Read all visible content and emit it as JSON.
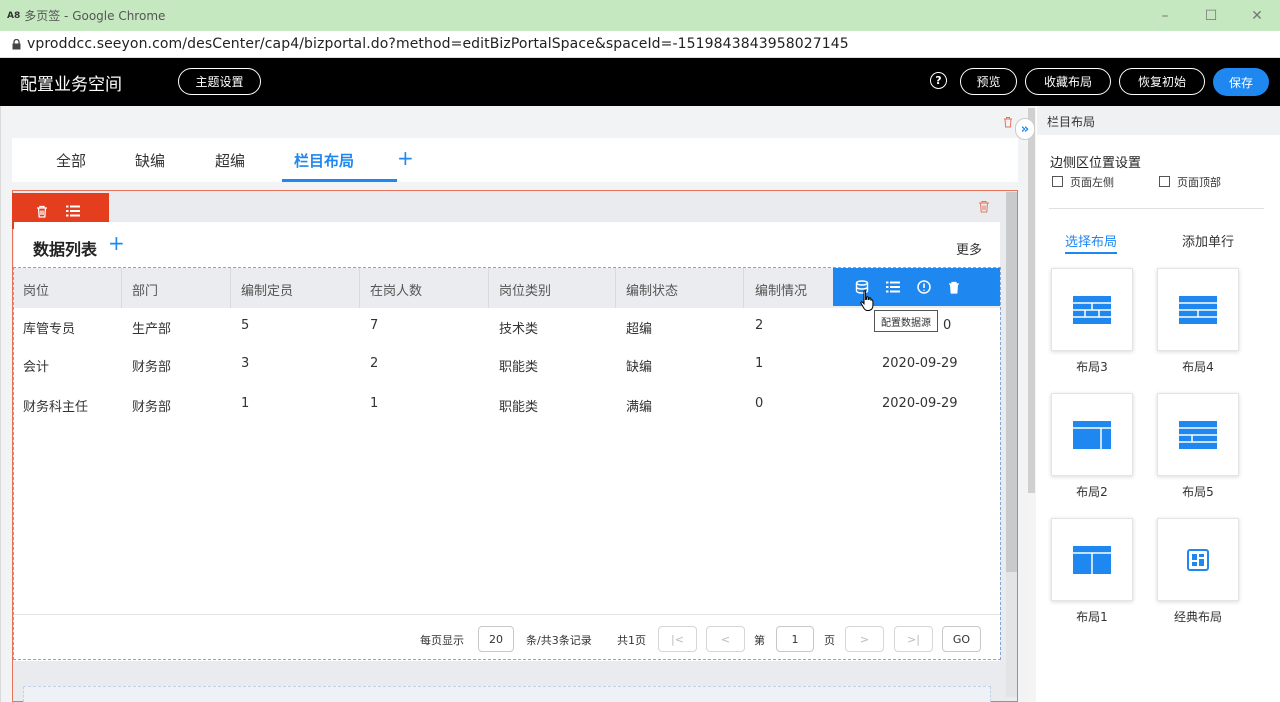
{
  "browser": {
    "app_icon": "A8",
    "window_title": "多页签 - Google Chrome",
    "url": "vproddcc.seeyon.com/desCenter/cap4/bizportal.do?method=editBizPortalSpace&spaceId=-1519843843958027145",
    "minimize": "–",
    "maximize": "☐",
    "close": "✕"
  },
  "header": {
    "title": "配置业务空间",
    "theme_button": "主题设置",
    "help": "?",
    "preview_button": "预览",
    "collect_button": "收藏布局",
    "restore_button": "恢复初始",
    "save_button": "保存"
  },
  "tabs": {
    "items": [
      "全部",
      "缺编",
      "超编",
      "栏目布局"
    ],
    "active_index": 3,
    "add": "+"
  },
  "panel": {
    "title": "数据列表",
    "add": "+",
    "more": "更多"
  },
  "table": {
    "columns": [
      "岗位",
      "部门",
      "编制定员",
      "在岗人数",
      "岗位类别",
      "编制状态",
      "编制情况"
    ],
    "rows": [
      [
        "库管专员",
        "生产部",
        "5",
        "7",
        "技术类",
        "超编",
        "2",
        "0"
      ],
      [
        "会计",
        "财务部",
        "3",
        "2",
        "职能类",
        "缺编",
        "1",
        "2020-09-29"
      ],
      [
        "财务科主任",
        "财务部",
        "1",
        "1",
        "职能类",
        "满编",
        "0",
        "2020-09-29"
      ]
    ]
  },
  "hover_toolbar": {
    "tooltip": "配置数据源",
    "icons": [
      "database-icon",
      "list-icon",
      "info-icon",
      "trash-icon"
    ]
  },
  "pager": {
    "per_page_label": "每页显示",
    "per_page_value": "20",
    "summary": "条/共3条记录",
    "total_pages": "共1页",
    "first": "|<",
    "prev": "<",
    "page_label": "第",
    "page_value": "1",
    "page_suffix": "页",
    "next": ">",
    "last": ">|",
    "go": "GO"
  },
  "right_panel": {
    "header": "栏目布局",
    "section_title": "边侧区位置设置",
    "checkbox_left": "页面左侧",
    "checkbox_top": "页面顶部",
    "tab_select": "选择布局",
    "tab_add_row": "添加单行",
    "layouts": [
      "布局3",
      "布局4",
      "布局2",
      "布局5",
      "布局1",
      "经典布局"
    ]
  },
  "colors": {
    "accent": "#1e87f0",
    "danger": "#e53e1e",
    "titlebar": "#c6e8c1"
  }
}
